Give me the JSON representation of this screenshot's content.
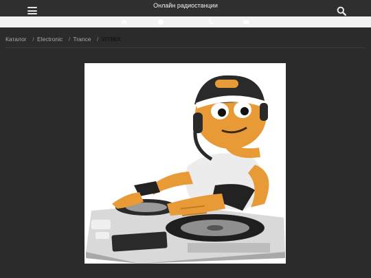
{
  "header": {
    "title": "Онлайн радиостанции",
    "menu_icon": "hamburger-icon",
    "search_icon": "search-icon"
  },
  "iconbar": {
    "icons": [
      "home-icon",
      "info-icon",
      "phone-icon",
      "mail-icon"
    ]
  },
  "breadcrumb": {
    "items": [
      "Каталог",
      "Electronic",
      "Trance"
    ],
    "current": "VITMIX"
  },
  "cover": {
    "image": "dj-cartoon-character-at-turntables"
  },
  "colors": {
    "background": "#2b2b2b",
    "topbar": "#2f2f2f",
    "iconbar": "#f2f2f2",
    "breadcrumb_text": "#aaaaaa"
  }
}
